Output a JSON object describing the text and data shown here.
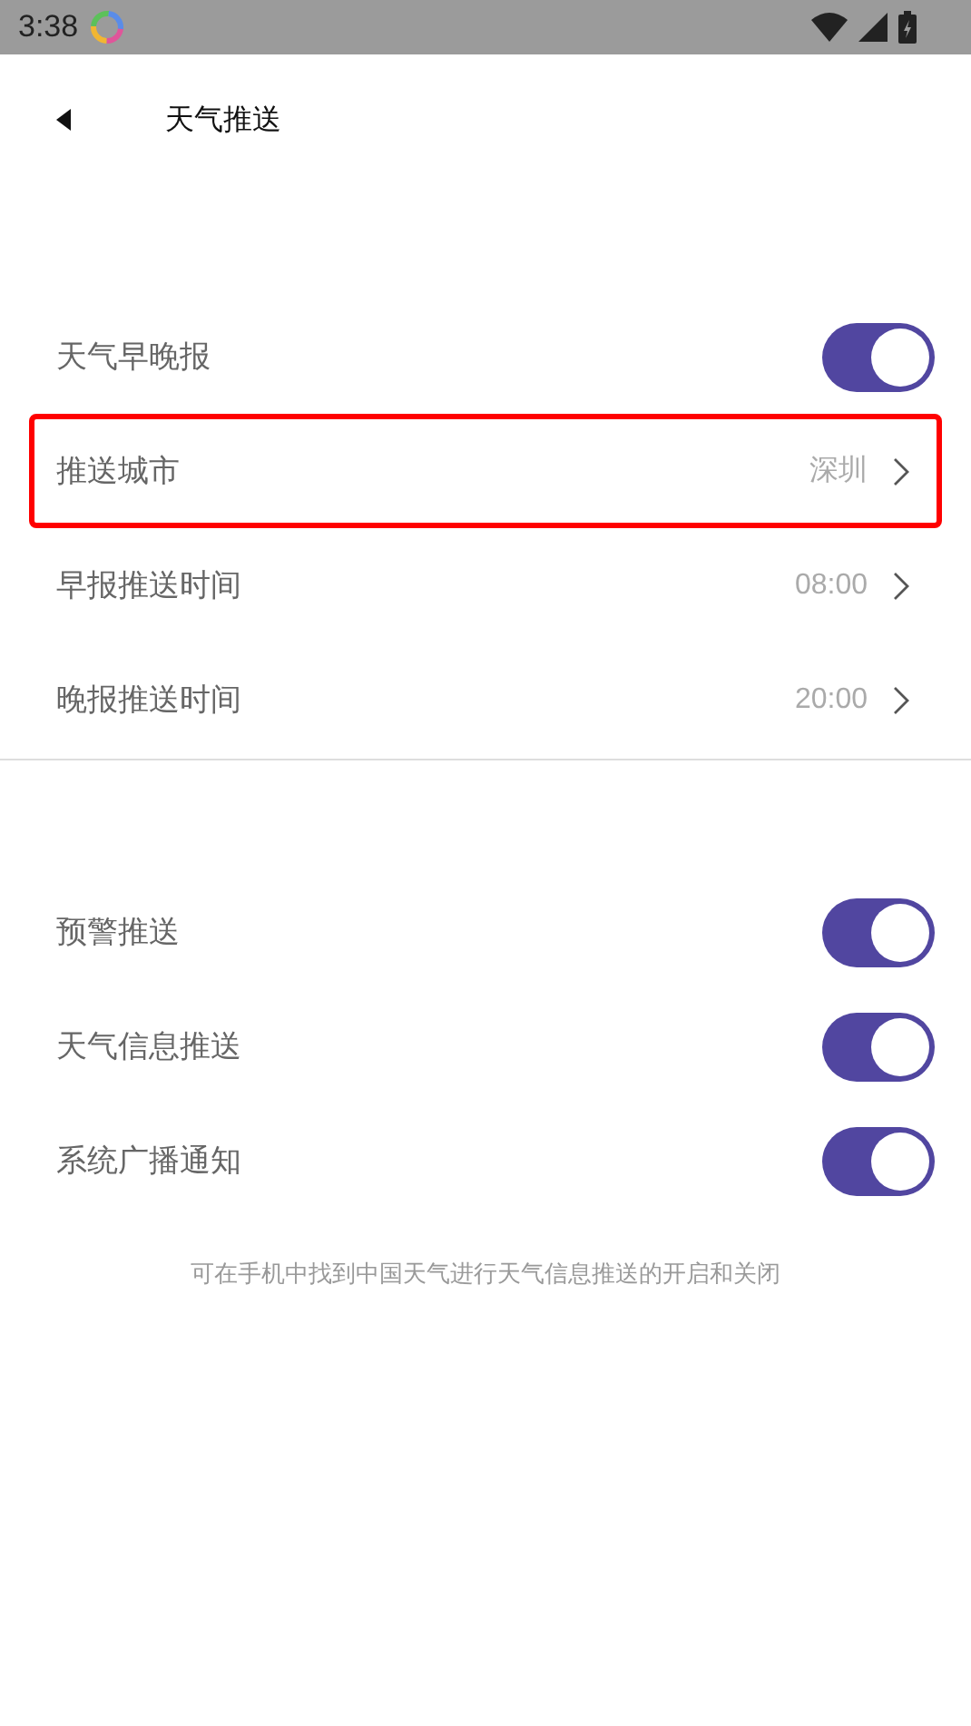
{
  "status_bar": {
    "time": "3:38"
  },
  "header": {
    "title": "天气推送"
  },
  "groups": [
    {
      "rows": [
        {
          "kind": "toggle",
          "label": "天气早晚报",
          "on": true,
          "selected": false
        },
        {
          "kind": "link",
          "label": "推送城市",
          "value": "深圳",
          "selected": true
        },
        {
          "kind": "link",
          "label": "早报推送时间",
          "value": "08:00",
          "selected": false
        },
        {
          "kind": "link",
          "label": "晚报推送时间",
          "value": "20:00",
          "selected": false
        }
      ]
    },
    {
      "rows": [
        {
          "kind": "toggle",
          "label": "预警推送",
          "on": true,
          "selected": false
        },
        {
          "kind": "toggle",
          "label": "天气信息推送",
          "on": true,
          "selected": false
        },
        {
          "kind": "toggle",
          "label": "系统广播通知",
          "on": true,
          "selected": false
        }
      ]
    }
  ],
  "footnote": "可在手机中找到中国天气进行天气信息推送的开启和关闭"
}
